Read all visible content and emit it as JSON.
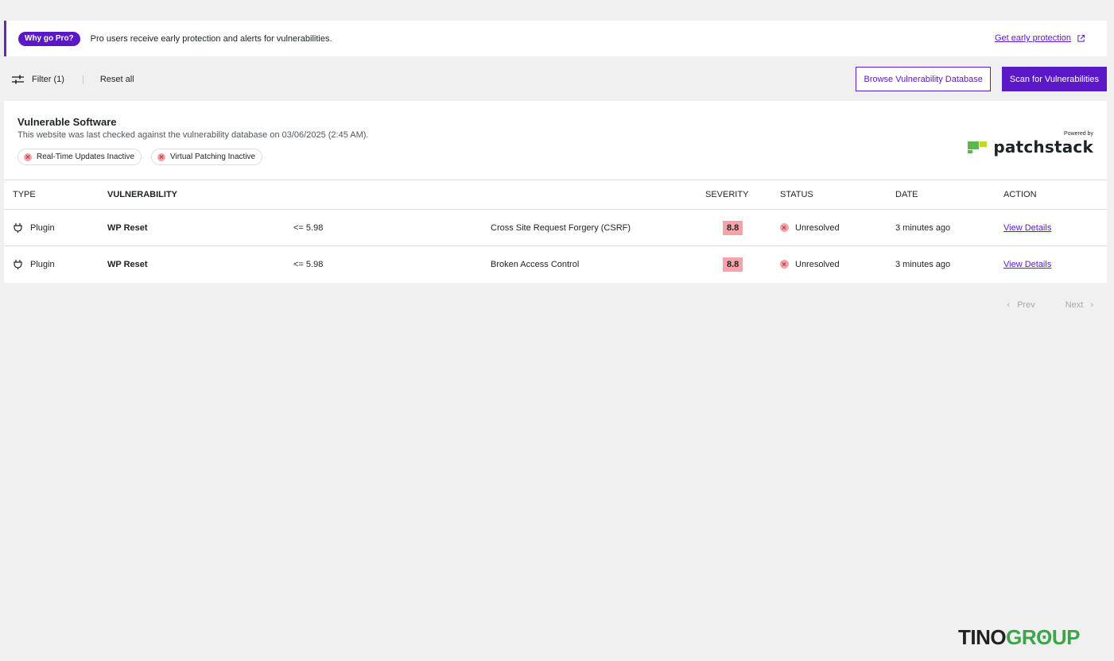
{
  "banner": {
    "pill": "Why go Pro?",
    "text": "Pro users receive early protection and alerts for vulnerabilities.",
    "link": "Get early protection"
  },
  "toolbar": {
    "filter_label": "Filter (1)",
    "separator": "|",
    "reset_label": "Reset all",
    "browse_label": "Browse Vulnerability Database",
    "scan_label": "Scan for Vulnerabilities"
  },
  "card": {
    "title": "Vulnerable Software",
    "subtitle": "This website was last checked against the vulnerability database on 03/06/2025 (2:45 AM).",
    "chips": [
      "Real-Time Updates Inactive",
      "Virtual Patching Inactive"
    ],
    "powered_by": "Powered by",
    "brand": "patchstack"
  },
  "table": {
    "headers": {
      "type": "TYPE",
      "vulnerability": "VULNERABILITY",
      "severity": "SEVERITY",
      "status": "STATUS",
      "date": "DATE",
      "action": "ACTION"
    },
    "rows": [
      {
        "type": "Plugin",
        "name": "WP Reset",
        "version": "<= 5.98",
        "title": "Cross Site Request Forgery (CSRF)",
        "severity": "8.8",
        "status": "Unresolved",
        "date": "3 minutes ago",
        "action": "View Details"
      },
      {
        "type": "Plugin",
        "name": "WP Reset",
        "version": "<= 5.98",
        "title": "Broken Access Control",
        "severity": "8.8",
        "status": "Unresolved",
        "date": "3 minutes ago",
        "action": "View Details"
      }
    ]
  },
  "pager": {
    "prev": "Prev",
    "next": "Next"
  },
  "watermark": {
    "part1": "TINO",
    "part2": "GRʘUP"
  },
  "colors": {
    "accent": "#5b18c6",
    "severity_high": "#f4a3a8",
    "brand_green": "#59b947"
  },
  "icons": {
    "filter": "sliders-icon",
    "external": "external-link-icon",
    "type": "plug-icon",
    "status": "x-circle-icon"
  }
}
